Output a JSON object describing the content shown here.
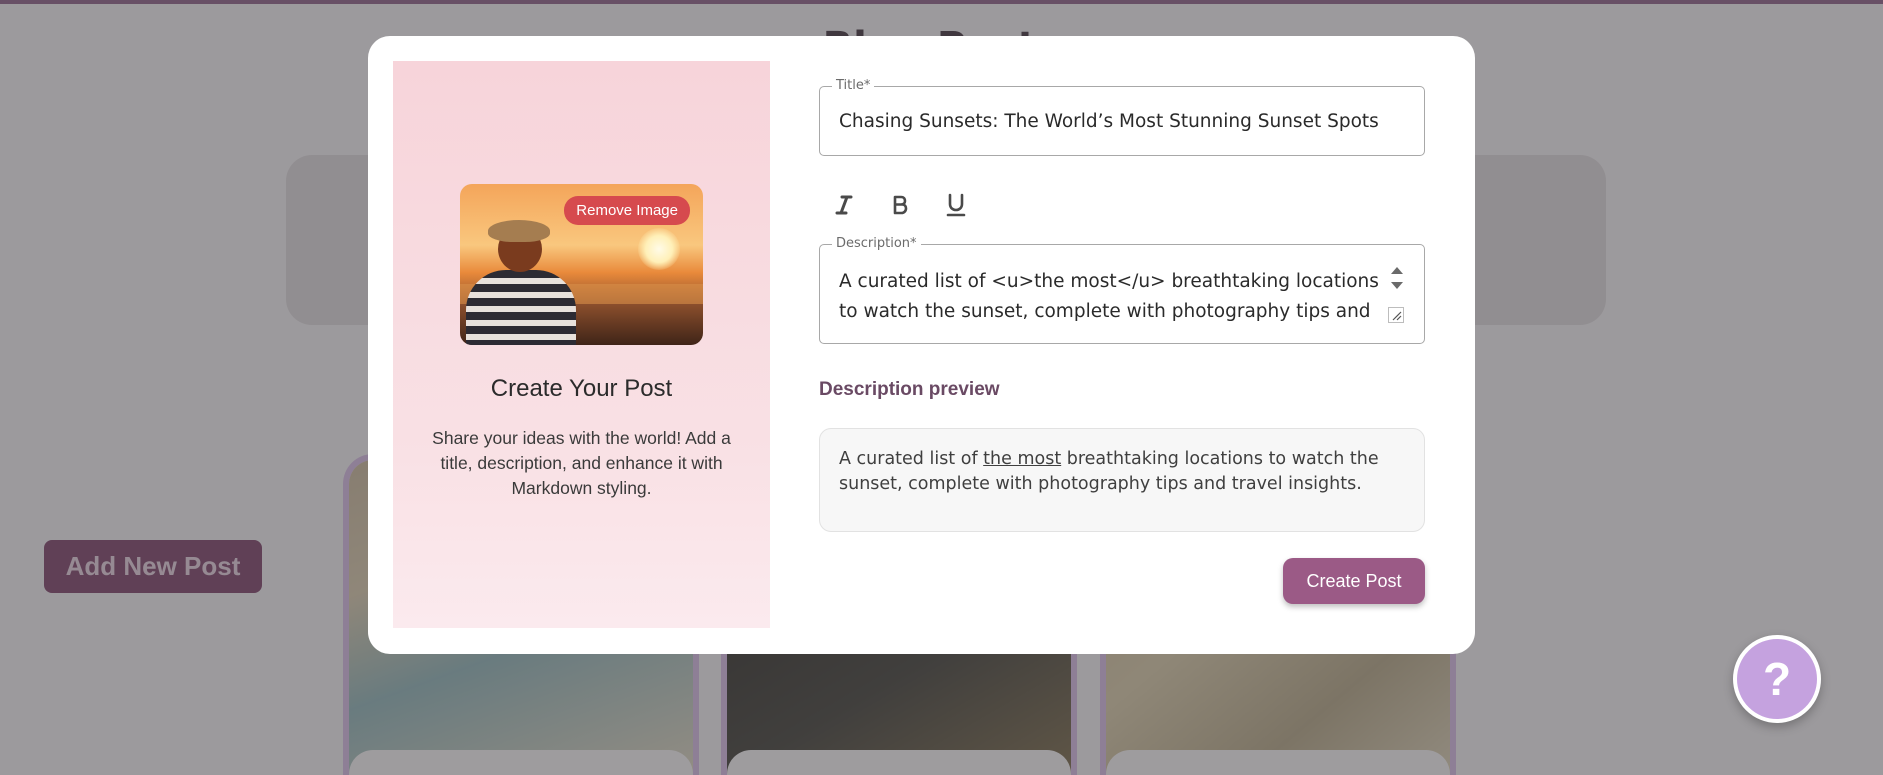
{
  "background": {
    "page_heading": "Blog Posts",
    "add_new_post_label": "Add New Post"
  },
  "help": {
    "label": "?"
  },
  "modal": {
    "left": {
      "remove_image_label": "Remove Image",
      "title": "Create Your Post",
      "description": "Share your ideas with the world! Add a title, description, and enhance it with Markdown styling."
    },
    "title_field": {
      "legend": "Title*",
      "value": "Chasing Sunsets: The World’s Most Stunning Sunset Spots"
    },
    "toolbar": {
      "italic_icon": "italic-icon",
      "bold_icon": "bold-icon",
      "underline_icon": "underline-icon"
    },
    "description_field": {
      "legend": "Description*",
      "value": "A curated list of <u>the most</u> breathtaking locations to watch the sunset, complete with photography tips and travel insights."
    },
    "preview": {
      "label": "Description preview",
      "before": "A curated list of ",
      "underlined": "the most",
      "after": " breathtaking locations to watch the sunset, complete with photography tips and travel insights."
    },
    "create_post_label": "Create Post"
  },
  "colors": {
    "accent": "#9b5a86",
    "remove_button": "#d64a4e",
    "help_fab": "#c5a2df",
    "left_pane": "#f7d4da"
  }
}
